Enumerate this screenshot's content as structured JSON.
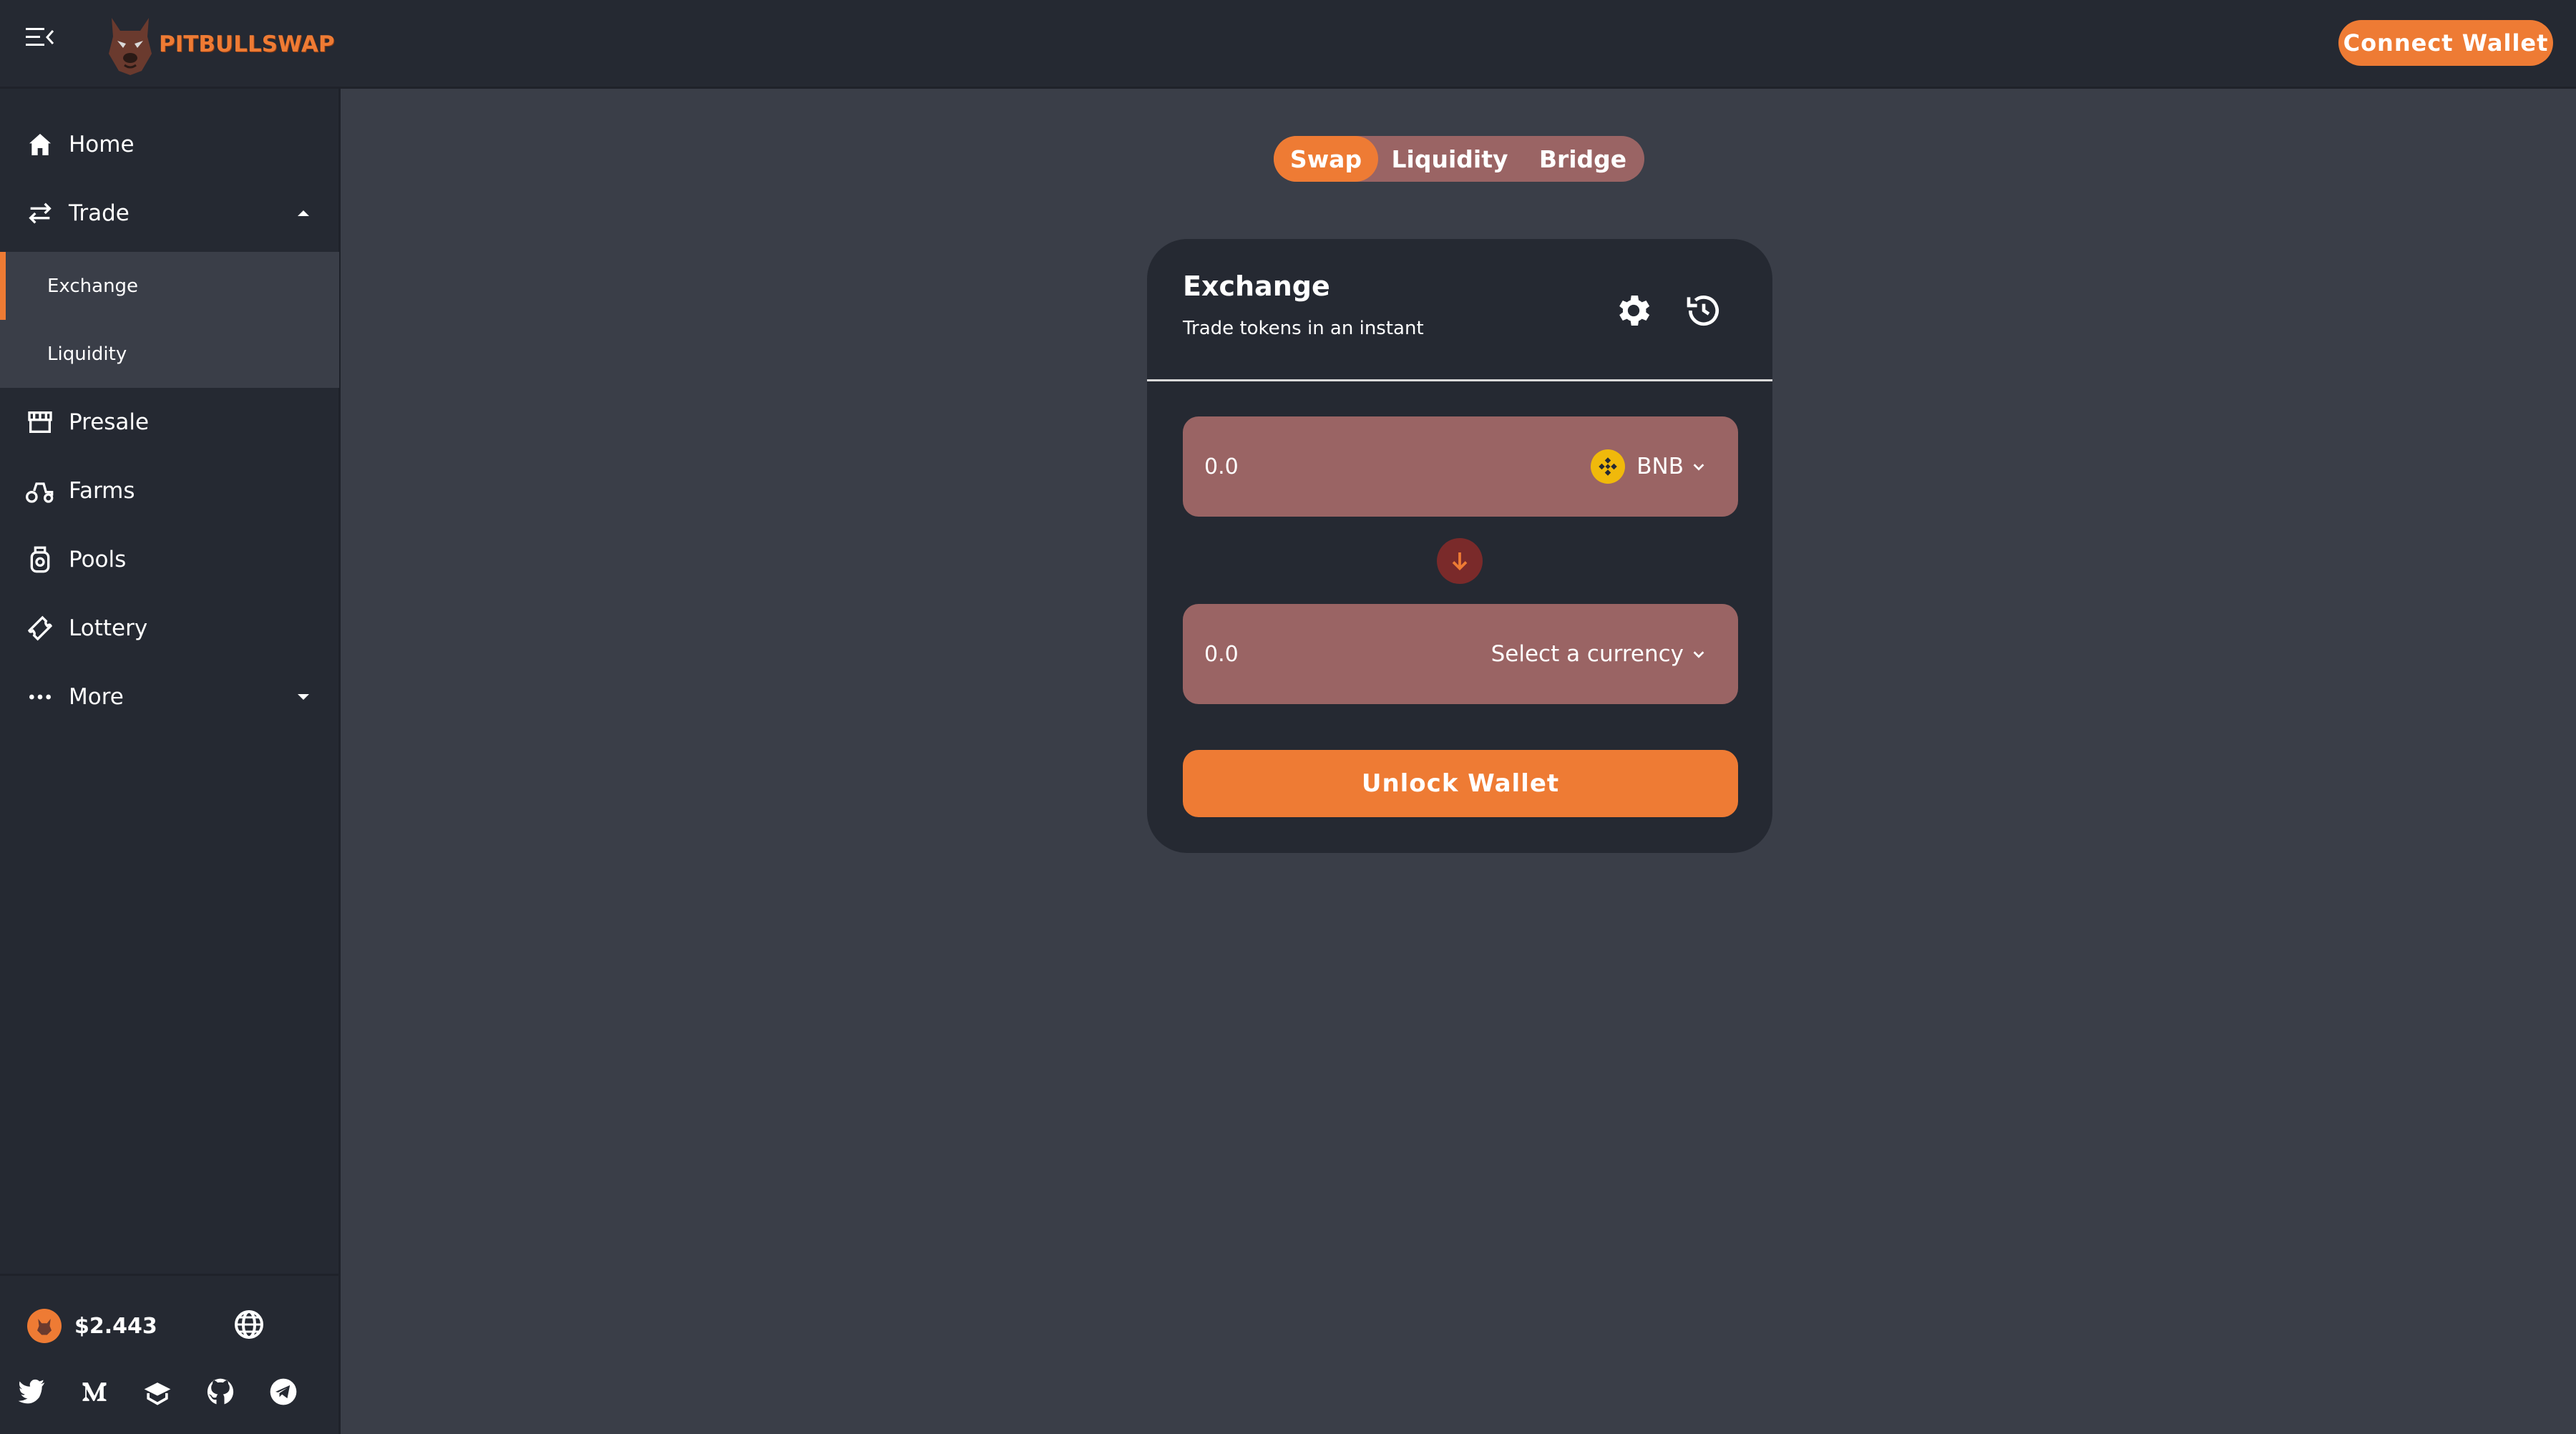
{
  "brand": {
    "name": "PITBULLSWAP",
    "accent": "#ee7b34"
  },
  "header": {
    "connect_label": "Connect Wallet"
  },
  "sidebar": {
    "items": [
      {
        "label": "Home",
        "icon": "home-icon"
      },
      {
        "label": "Trade",
        "icon": "swap-arrows-icon",
        "expanded": true
      },
      {
        "label": "Presale",
        "icon": "store-icon"
      },
      {
        "label": "Farms",
        "icon": "tractor-icon"
      },
      {
        "label": "Pools",
        "icon": "honey-pot-icon"
      },
      {
        "label": "Lottery",
        "icon": "ticket-icon"
      },
      {
        "label": "More",
        "icon": "more-dots-icon",
        "expanded": false
      }
    ],
    "trade_submenu": [
      {
        "label": "Exchange",
        "active": true
      },
      {
        "label": "Liquidity",
        "active": false
      }
    ],
    "footer": {
      "price": "$2.443",
      "socials": [
        "twitter-icon",
        "medium-icon",
        "docs-icon",
        "github-icon",
        "telegram-icon"
      ]
    }
  },
  "tabs": [
    {
      "label": "Swap",
      "active": true
    },
    {
      "label": "Liquidity",
      "active": false
    },
    {
      "label": "Bridge",
      "active": false
    }
  ],
  "exchange": {
    "title": "Exchange",
    "subtitle": "Trade tokens in an instant",
    "from": {
      "placeholder": "0.0",
      "currency": "BNB"
    },
    "to": {
      "placeholder": "0.0",
      "currency": "Select a currency"
    },
    "unlock_label": "Unlock Wallet"
  }
}
